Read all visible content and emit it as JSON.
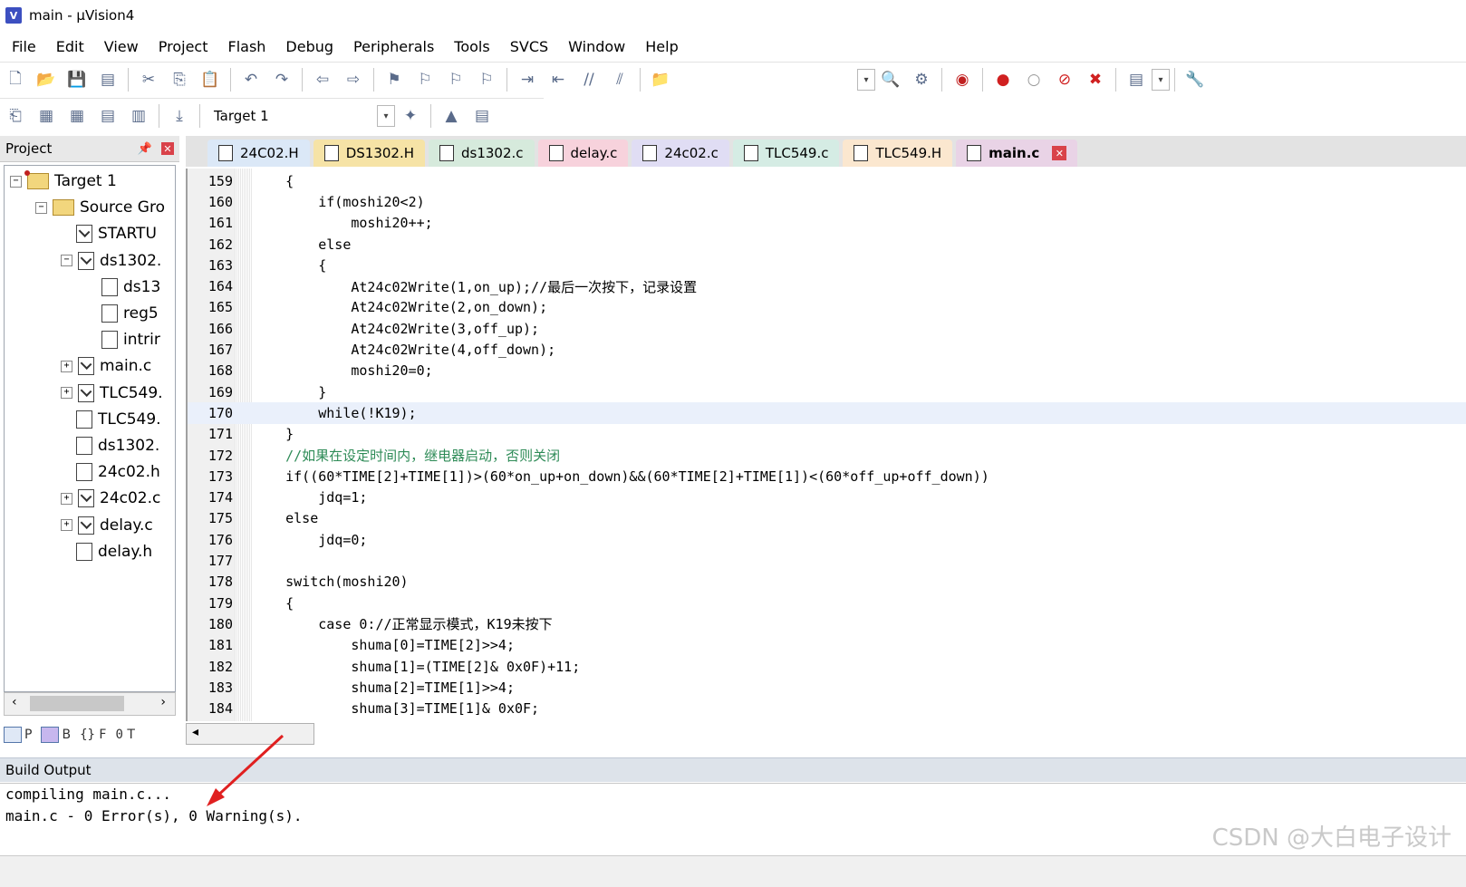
{
  "window": {
    "title": "main  - µVision4",
    "icon_letter": "V"
  },
  "menu": [
    "File",
    "Edit",
    "View",
    "Project",
    "Flash",
    "Debug",
    "Peripherals",
    "Tools",
    "SVCS",
    "Window",
    "Help"
  ],
  "toolbar2": {
    "target": "Target 1"
  },
  "project": {
    "title": "Project",
    "tree": [
      {
        "label": "Target 1",
        "level": 0,
        "exp": "−",
        "icon": "target"
      },
      {
        "label": "Source Gro",
        "level": 1,
        "exp": "−",
        "icon": "folder"
      },
      {
        "label": "STARTU",
        "level": 2,
        "exp": "",
        "icon": "file-dl"
      },
      {
        "label": "ds1302.",
        "level": 2,
        "exp": "−",
        "icon": "file-dl"
      },
      {
        "label": "ds13",
        "level": 3,
        "exp": "",
        "icon": "file"
      },
      {
        "label": "reg5",
        "level": 3,
        "exp": "",
        "icon": "file"
      },
      {
        "label": "intrir",
        "level": 3,
        "exp": "",
        "icon": "file"
      },
      {
        "label": "main.c",
        "level": 2,
        "exp": "+",
        "icon": "file-dl"
      },
      {
        "label": "TLC549.",
        "level": 2,
        "exp": "+",
        "icon": "file-dl"
      },
      {
        "label": "TLC549.",
        "level": 2,
        "exp": "",
        "icon": "file"
      },
      {
        "label": "ds1302.",
        "level": 2,
        "exp": "",
        "icon": "file"
      },
      {
        "label": "24c02.h",
        "level": 2,
        "exp": "",
        "icon": "file"
      },
      {
        "label": "24c02.c",
        "level": 2,
        "exp": "+",
        "icon": "file-dl"
      },
      {
        "label": "delay.c",
        "level": 2,
        "exp": "+",
        "icon": "file-dl"
      },
      {
        "label": "delay.h",
        "level": 2,
        "exp": "",
        "icon": "file"
      }
    ],
    "panel_tabs": [
      "P",
      "B",
      "F",
      "T"
    ]
  },
  "tabs": [
    {
      "label": "24C02.H",
      "color": "#dbe8f7"
    },
    {
      "label": "DS1302.H",
      "color": "#f6e3a6"
    },
    {
      "label": "ds1302.c",
      "color": "#d6eadc"
    },
    {
      "label": "delay.c",
      "color": "#f7d2dc"
    },
    {
      "label": "24c02.c",
      "color": "#e0ddf4"
    },
    {
      "label": "TLC549.c",
      "color": "#d5ece4"
    },
    {
      "label": "TLC549.H",
      "color": "#fbe7cf"
    },
    {
      "label": "main.c",
      "color": "#e9d3e6",
      "active": true
    }
  ],
  "code": [
    {
      "n": "159",
      "t": "    {"
    },
    {
      "n": "160",
      "t": "        if(moshi20<2)"
    },
    {
      "n": "161",
      "t": "            moshi20++;"
    },
    {
      "n": "162",
      "t": "        else"
    },
    {
      "n": "163",
      "t": "        {"
    },
    {
      "n": "164",
      "t": "            At24c02Write(1,on_up);//最后一次按下，记录设置"
    },
    {
      "n": "165",
      "t": "            At24c02Write(2,on_down);"
    },
    {
      "n": "166",
      "t": "            At24c02Write(3,off_up);"
    },
    {
      "n": "167",
      "t": "            At24c02Write(4,off_down);"
    },
    {
      "n": "168",
      "t": "            moshi20=0;"
    },
    {
      "n": "169",
      "t": "        }"
    },
    {
      "n": "170",
      "t": "        while(!K19);",
      "cur": true
    },
    {
      "n": "171",
      "t": "    }"
    },
    {
      "n": "172",
      "t": "    //如果在设定时间内，继电器启动，否则关闭"
    },
    {
      "n": "173",
      "t": "    if((60*TIME[2]+TIME[1])>(60*on_up+on_down)&&(60*TIME[2]+TIME[1])<(60*off_up+off_down))"
    },
    {
      "n": "174",
      "t": "        jdq=1;"
    },
    {
      "n": "175",
      "t": "    else"
    },
    {
      "n": "176",
      "t": "        jdq=0;"
    },
    {
      "n": "177",
      "t": ""
    },
    {
      "n": "178",
      "t": "    switch(moshi20)"
    },
    {
      "n": "179",
      "t": "    {"
    },
    {
      "n": "180",
      "t": "        case 0://正常显示模式，K19未按下"
    },
    {
      "n": "181",
      "t": "            shuma[0]=TIME[2]>>4;"
    },
    {
      "n": "182",
      "t": "            shuma[1]=(TIME[2]& 0x0F)+11;"
    },
    {
      "n": "183",
      "t": "            shuma[2]=TIME[1]>>4;"
    },
    {
      "n": "184",
      "t": "            shuma[3]=TIME[1]& 0x0F;"
    }
  ],
  "build": {
    "title": "Build Output",
    "lines": [
      "compiling main.c...",
      "main.c - 0 Error(s), 0 Warning(s)."
    ]
  },
  "watermark": "CSDN @大白电子设计",
  "colors": {
    "accent": "#2f66b8",
    "comment": "#2e8b57",
    "arrow": "#e02020"
  }
}
